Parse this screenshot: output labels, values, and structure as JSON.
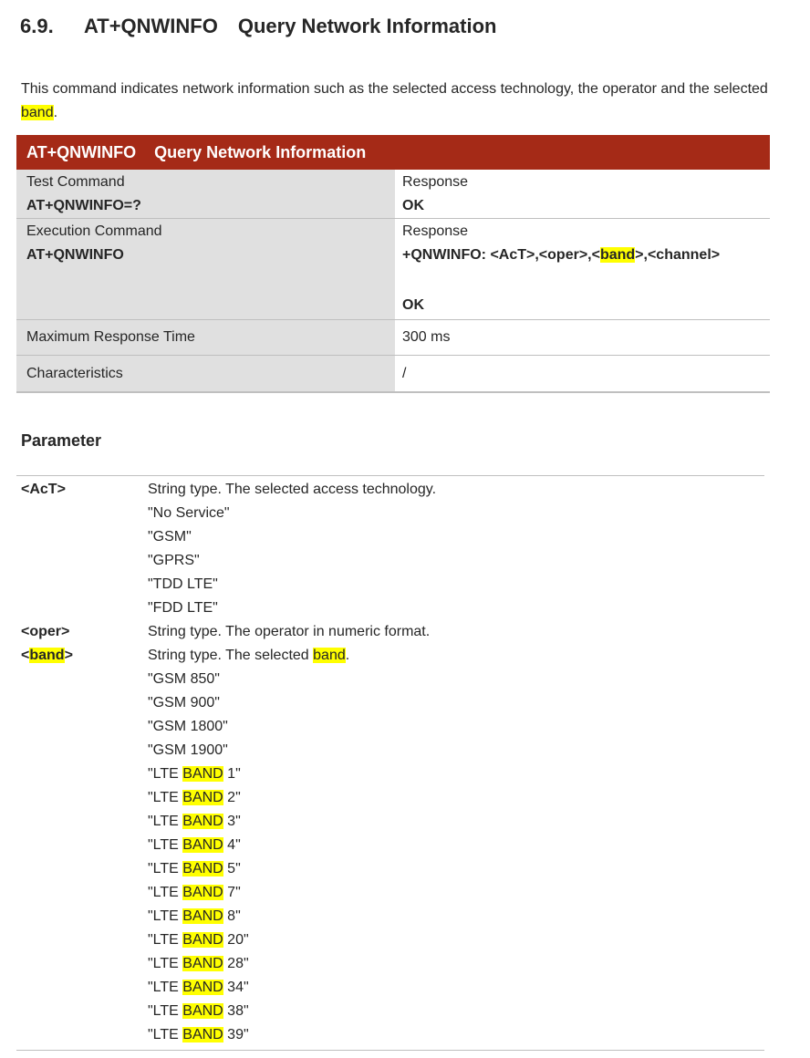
{
  "heading": {
    "number": "6.9.",
    "command": "AT+QNWINFO",
    "title": "Query Network Information"
  },
  "intro": {
    "text_before": "This command indicates network information such as the selected access technology, the operator and the selected ",
    "highlight": "band",
    "text_after": "."
  },
  "table": {
    "header": {
      "command": "AT+QNWINFO",
      "title": "Query Network Information"
    },
    "test": {
      "label": "Test Command",
      "command": "AT+QNWINFO=?",
      "response_label": "Response",
      "response": "OK"
    },
    "exec": {
      "label": "Execution Command",
      "command": "AT+QNWINFO",
      "response_label": "Response",
      "response_pre": "+QNWINFO: <AcT>,<oper>,<",
      "response_hl": "band",
      "response_post": ">,<channel>",
      "response_ok": "OK"
    },
    "max_time": {
      "label": "Maximum Response Time",
      "value": "300 ms"
    },
    "characteristics": {
      "label": "Characteristics",
      "value": "/"
    }
  },
  "parameter": {
    "heading": "Parameter",
    "act": {
      "name": "<AcT>",
      "desc": "String type. The selected access technology.",
      "values": [
        "\"No Service\"",
        "\"GSM\"",
        "\"GPRS\"",
        "\"TDD LTE\"",
        "\"FDD LTE\""
      ]
    },
    "oper": {
      "name": "<oper>",
      "desc": "String type. The operator in numeric format."
    },
    "band": {
      "name_pre": "<",
      "name_hl": "band",
      "name_post": ">",
      "desc_pre": "String type. The selected ",
      "desc_hl": "band",
      "desc_post": ".",
      "gsm_values": [
        "\"GSM 850\"",
        "\"GSM 900\"",
        "\"GSM 1800\"",
        "\"GSM 1900\""
      ],
      "lte_prefix": "\"LTE ",
      "lte_hl": "BAND",
      "lte_suffixes": [
        " 1\"",
        " 2\"",
        " 3\"",
        " 4\"",
        " 5\"",
        " 7\"",
        " 8\"",
        " 20\"",
        " 28\"",
        " 34\"",
        " 38\"",
        " 39\""
      ]
    }
  }
}
